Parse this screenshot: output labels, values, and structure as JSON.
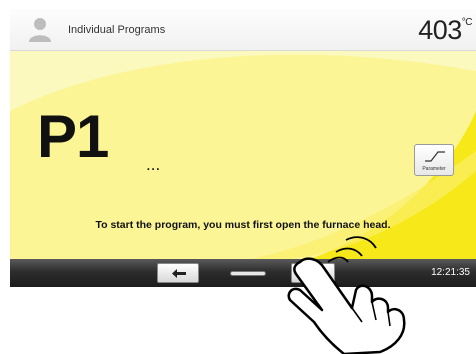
{
  "header": {
    "title": "Individual Programs",
    "temperature_value": "403",
    "temperature_unit": "°C"
  },
  "program": {
    "name": "P1",
    "ellipsis": "..."
  },
  "parameter_button": {
    "label": "Parameter"
  },
  "message": "To start the program, you must first open the furnace head.",
  "bottombar": {
    "time": "12:21:35"
  },
  "icons": {
    "user": "user-icon",
    "parameter": "curve-icon",
    "back": "arrow-left-icon",
    "hand": "pointing-hand-icon"
  },
  "colors": {
    "panel_background": "#fbf596",
    "accent_yellow": "#f7e81a",
    "bottombar": "#2d2d2d"
  }
}
